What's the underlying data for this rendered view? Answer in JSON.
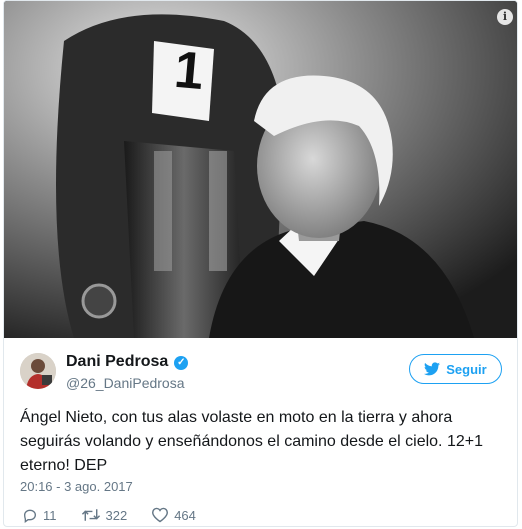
{
  "photo": {
    "alt_icon": "info-icon",
    "bib_number": "1"
  },
  "author": {
    "name": "Dani Pedrosa",
    "handle": "@26_DaniPedrosa",
    "verified": true
  },
  "follow_label": "Seguir",
  "tweet": {
    "line1": "Ángel Nieto, con tus alas volaste en moto en la tierra y ahora",
    "line2": "seguirás volando y enseñándonos el camino desde el cielo. 12+1",
    "line3": "eterno! DEP"
  },
  "timestamp": "20:16 - 3 ago. 2017",
  "actions": {
    "replies": "11",
    "retweets": "322",
    "likes": "464"
  },
  "colors": {
    "accent": "#1da1f2",
    "muted": "#657786",
    "text": "#14171a"
  }
}
